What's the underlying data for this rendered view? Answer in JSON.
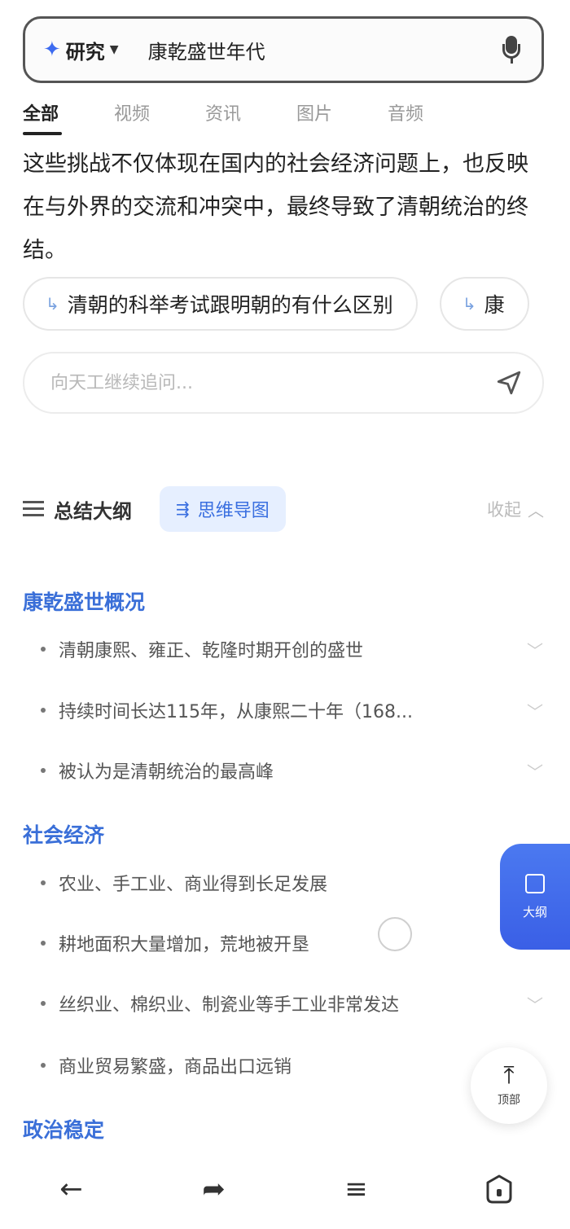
{
  "search": {
    "mode_label": "研究",
    "query": "康乾盛世年代"
  },
  "tabs": [
    {
      "label": "全部"
    },
    {
      "label": "视频"
    },
    {
      "label": "资讯"
    },
    {
      "label": "图片"
    },
    {
      "label": "音频"
    }
  ],
  "answer": {
    "paragraph": "这些挑战不仅体现在国内的社会经济问题上，也反映在与外界的交流和冲突中，最终导致了清朝统治的终结。"
  },
  "related": [
    {
      "label": "清朝的科举考试跟明朝的有什么区别"
    },
    {
      "label": "康"
    }
  ],
  "followup": {
    "placeholder": "向天工继续追问..."
  },
  "outline": {
    "title": "总结大纲",
    "mindmap_label": "思维导图",
    "collapse_label": "收起",
    "sections": [
      {
        "title": "康乾盛世概况",
        "items": [
          "清朝康熙、雍正、乾隆时期开创的盛世",
          "持续时间长达115年，从康熙二十年（168...",
          "被认为是清朝统治的最高峰"
        ]
      },
      {
        "title": "社会经济",
        "items": [
          "农业、手工业、商业得到长足发展",
          "耕地面积大量增加，荒地被开垦",
          "丝织业、棉织业、制瓷业等手工业非常发达",
          "商业贸易繁盛，商品出口远销"
        ]
      },
      {
        "title": "政治稳定",
        "items": []
      }
    ]
  },
  "floating": {
    "outline_label": "大纲",
    "top_label": "顶部"
  },
  "icons": {
    "mode": "sparkle-icon",
    "voice": "microphone-icon",
    "send": "send-icon",
    "back": "back-arrow-icon",
    "share": "share-icon",
    "menu": "menu-icon",
    "home": "home-icon"
  },
  "colors": {
    "accent": "#3a6fd8",
    "mindmap_bg": "#e6efff",
    "float_button": "#4b79f0"
  }
}
